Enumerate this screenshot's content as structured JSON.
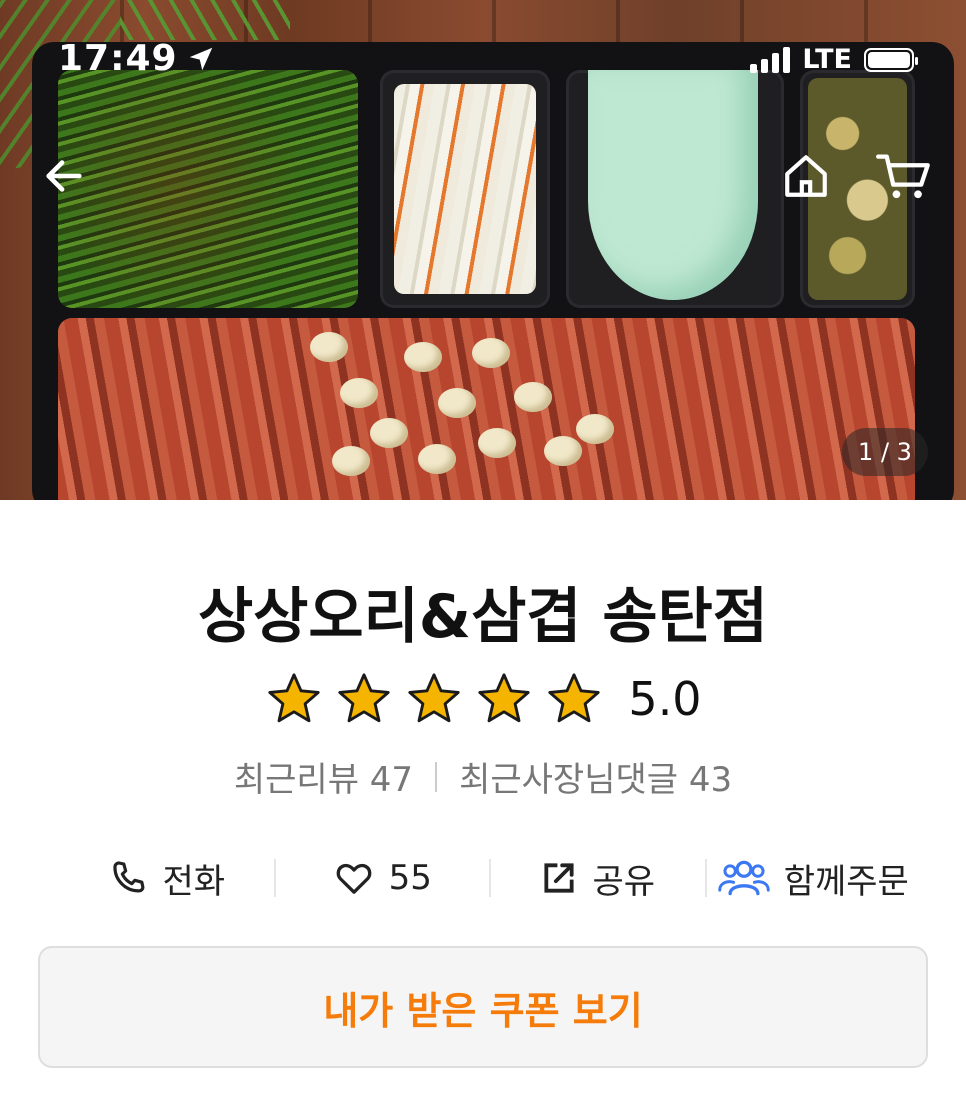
{
  "status_bar": {
    "time": "17:49",
    "network": "LTE"
  },
  "hero": {
    "pager": "1 / 3"
  },
  "store": {
    "name": "상상오리&삼겹 송탄점",
    "rating": "5.0",
    "stars": 5,
    "recent_reviews": "최근리뷰 47",
    "recent_owner_replies": "최근사장님댓글 43"
  },
  "actions": {
    "call": "전화",
    "like_count": "55",
    "share": "공유",
    "group_order": "함께주문"
  },
  "coupon_button": "내가 받은 쿠폰 보기",
  "colors": {
    "accent_orange": "#f57c0a",
    "star_gold": "#f5b400",
    "group_order_blue": "#3b78f2"
  }
}
